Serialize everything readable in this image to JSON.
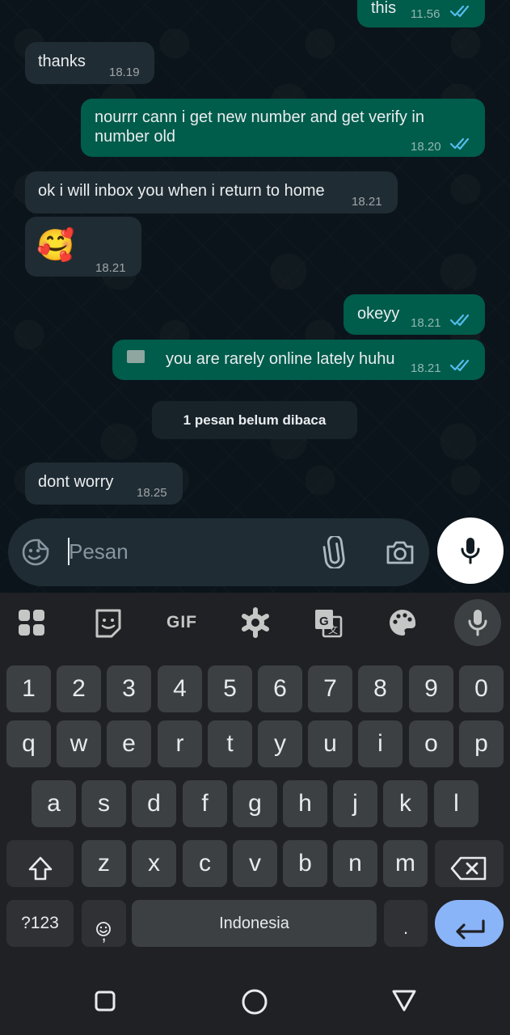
{
  "chat": {
    "messages": [
      {
        "dir": "out",
        "text": "this",
        "time": "11.56",
        "status": "read"
      },
      {
        "dir": "in",
        "text": "thanks",
        "time": "18.19"
      },
      {
        "dir": "out",
        "text_line1": "nourrr cann i get new number and get verify in",
        "text_line2": "number old",
        "time": "18.20",
        "status": "read"
      },
      {
        "dir": "in",
        "text": "ok i will inbox you when i return to home",
        "time": "18.21"
      },
      {
        "dir": "in",
        "text": "🥰",
        "time": "18.21"
      },
      {
        "dir": "out",
        "text": "okeyy",
        "time": "18.21",
        "status": "read"
      },
      {
        "dir": "out",
        "text": "you are rarely online lately huhu",
        "time": "18.21",
        "status": "read"
      },
      {
        "dir": "in",
        "text": "dont worry",
        "time": "18.25"
      }
    ],
    "unread_banner": "1 pesan belum dibaca"
  },
  "composer": {
    "placeholder": "Pesan",
    "icons": [
      "sticker-icon",
      "attach-icon",
      "camera-icon",
      "mic-icon"
    ]
  },
  "keyboard": {
    "toolbar": [
      "apps-grid-icon",
      "sticker-icon",
      "GIF",
      "settings-icon",
      "translate-icon",
      "palette-icon",
      "mic-icon"
    ],
    "gif_label": "GIF",
    "row_numbers": [
      "1",
      "2",
      "3",
      "4",
      "5",
      "6",
      "7",
      "8",
      "9",
      "0"
    ],
    "row_q": [
      "q",
      "w",
      "e",
      "r",
      "t",
      "y",
      "u",
      "i",
      "o",
      "p"
    ],
    "row_a": [
      "a",
      "s",
      "d",
      "f",
      "g",
      "h",
      "j",
      "k",
      "l"
    ],
    "row_z": [
      "z",
      "x",
      "c",
      "v",
      "b",
      "n",
      "m"
    ],
    "symbols_label": "?123",
    "comma_label": ",",
    "space_label": "Indonesia",
    "period_label": "."
  },
  "navbar": {
    "buttons": [
      "recents-square",
      "home-circle",
      "back-triangle"
    ]
  },
  "colors": {
    "chat_bg": "#0b141a",
    "incoming_bubble": "#202c33",
    "outgoing_bubble": "#005c4b",
    "read_ticks": "#53bdeb",
    "keyboard_bg": "#202124",
    "key_bg": "#3c4043",
    "enter_key": "#8ab4f8"
  }
}
